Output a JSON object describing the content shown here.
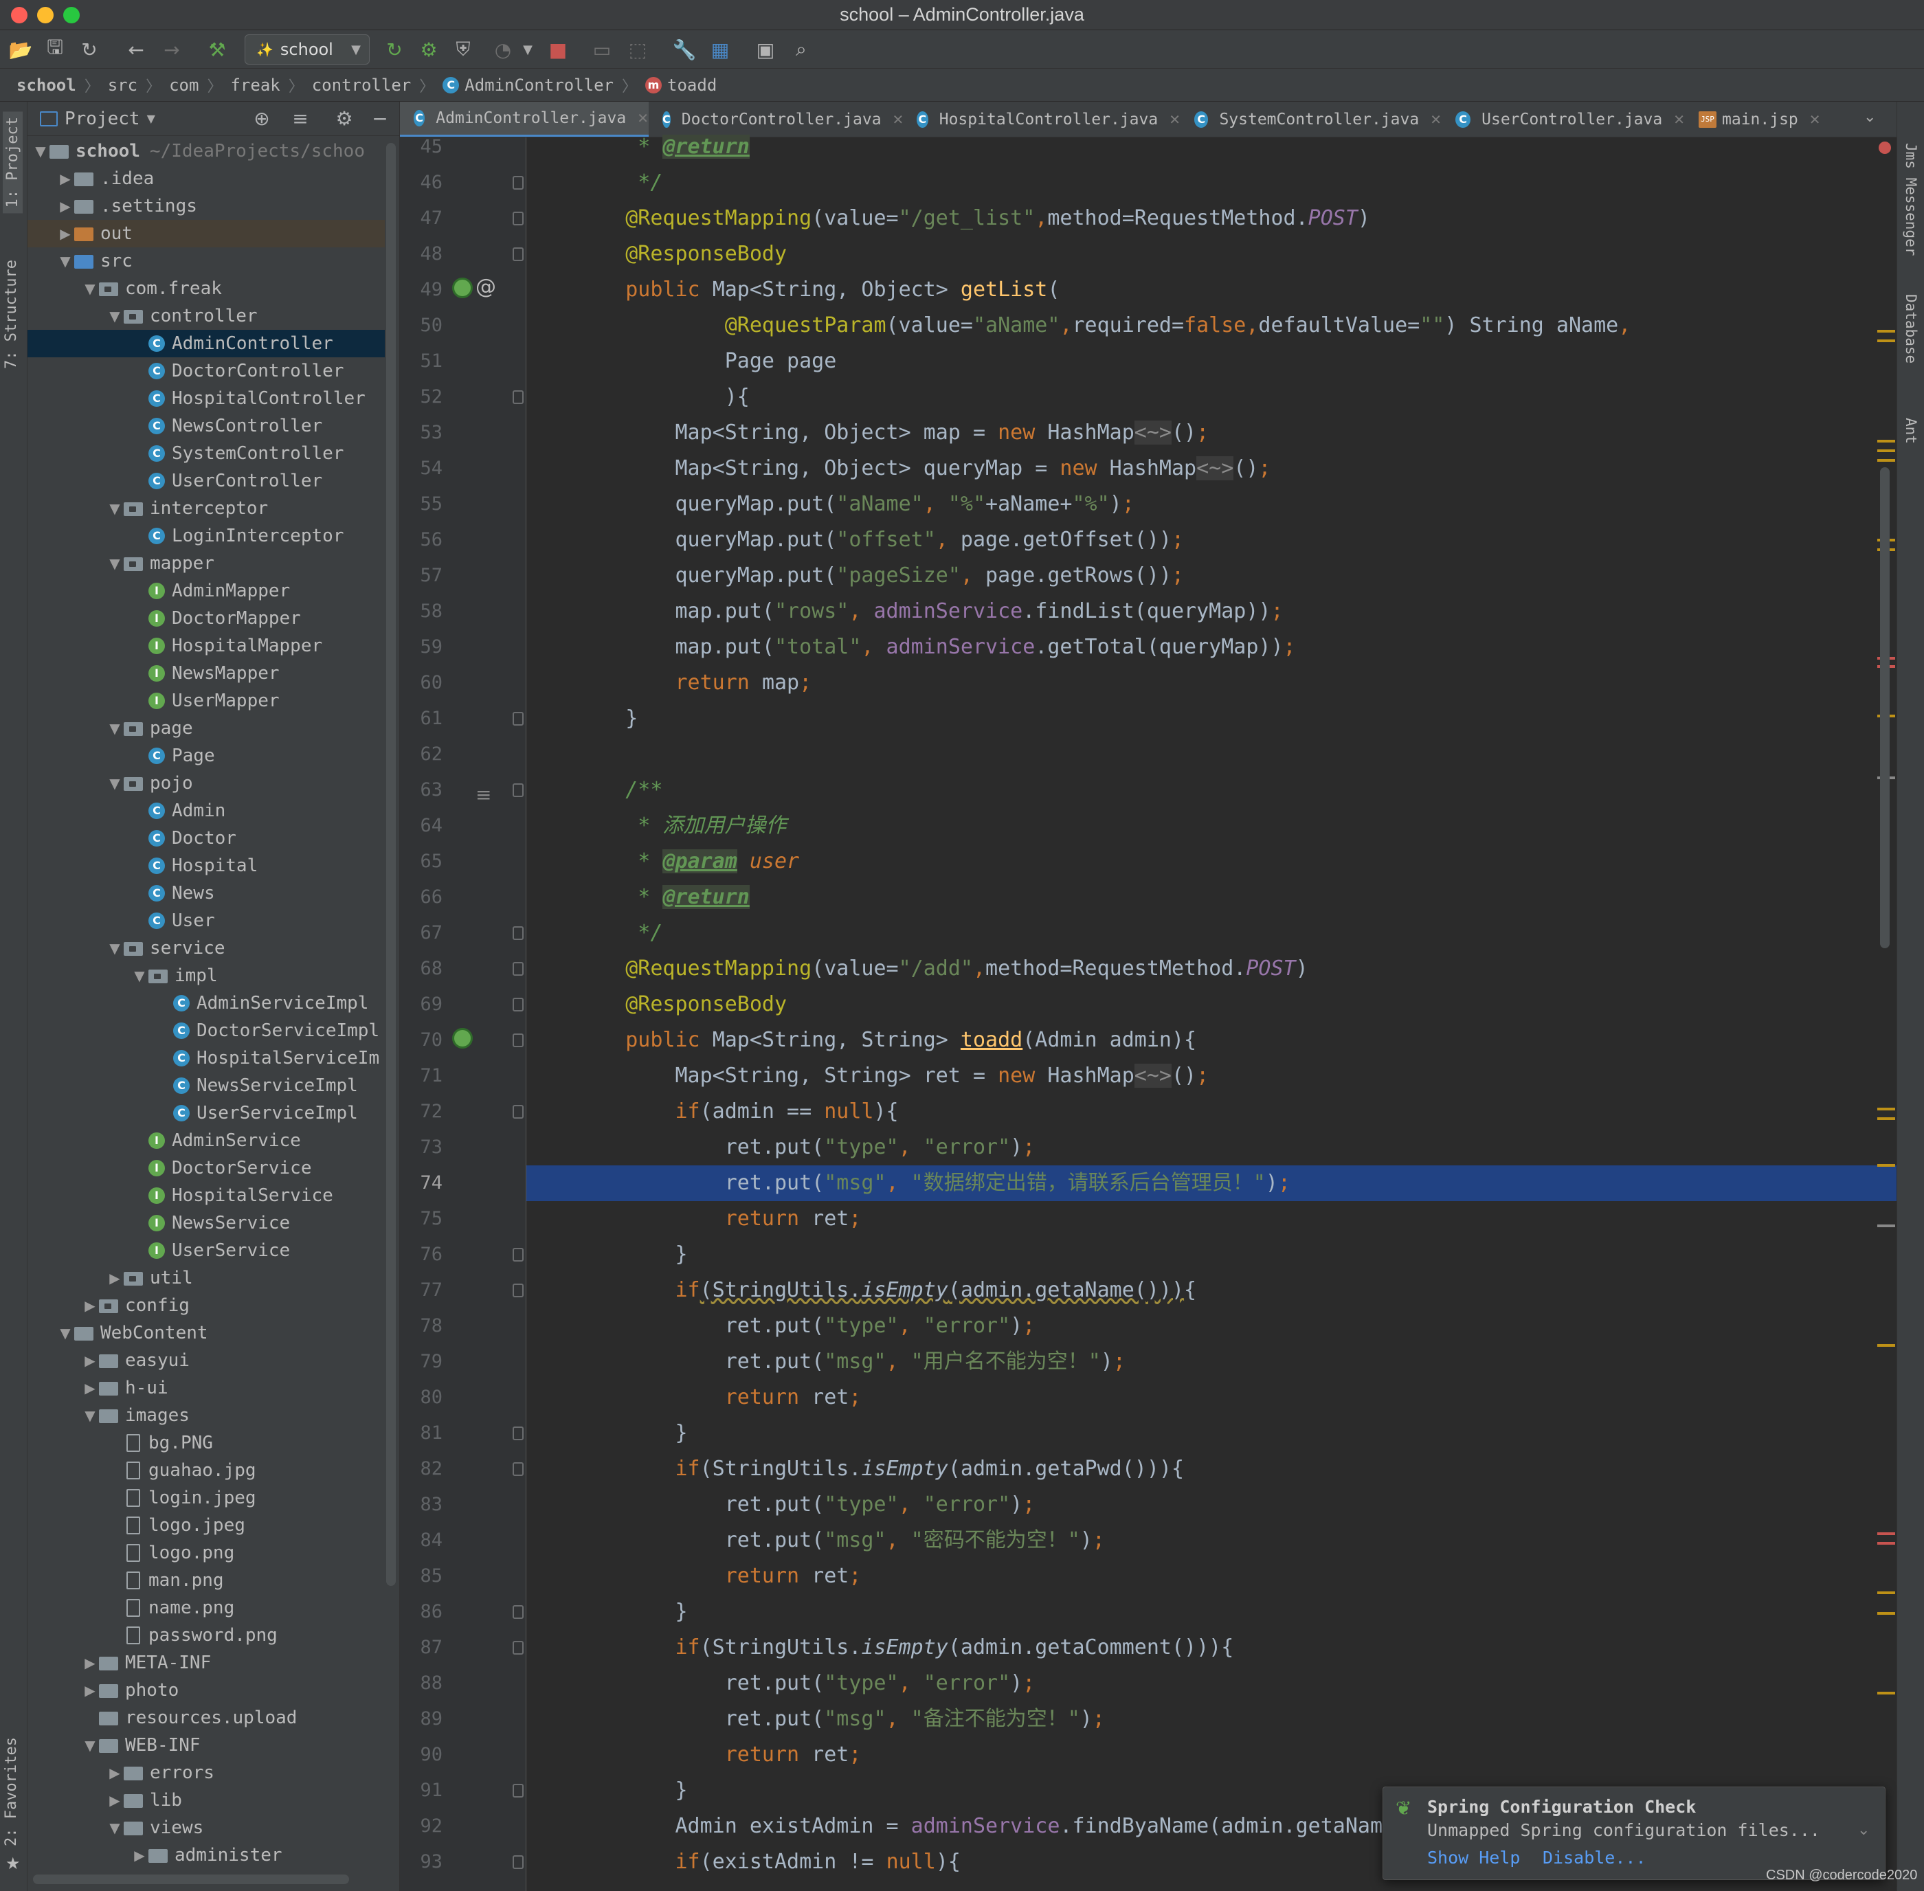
{
  "window": {
    "title": "school – AdminController.java"
  },
  "toolbar": {
    "run_config": "school"
  },
  "breadcrumb": [
    "school",
    "src",
    "com",
    "freak",
    "controller",
    "AdminController",
    "toadd"
  ],
  "left_tabs": {
    "project": "1: Project",
    "structure": "7: Structure",
    "favorites": "2: Favorites"
  },
  "right_tabs": {
    "jms": "Jms Messenger",
    "database": "Database",
    "ant": "Ant"
  },
  "project_panel": {
    "title": "Project"
  },
  "tree": [
    {
      "d": 0,
      "a": "▼",
      "t": "folder",
      "label": "school",
      "path": "~/IdeaProjects/schoo"
    },
    {
      "d": 1,
      "a": "▶",
      "t": "folder",
      "label": ".idea"
    },
    {
      "d": 1,
      "a": "▶",
      "t": "folder",
      "label": ".settings"
    },
    {
      "d": 1,
      "a": "▶",
      "t": "folder-orange",
      "label": "out"
    },
    {
      "d": 1,
      "a": "▼",
      "t": "folder-src",
      "label": "src"
    },
    {
      "d": 2,
      "a": "▼",
      "t": "pkg",
      "label": "com.freak"
    },
    {
      "d": 3,
      "a": "▼",
      "t": "pkg",
      "label": "controller"
    },
    {
      "d": 4,
      "a": "",
      "t": "class",
      "label": "AdminController"
    },
    {
      "d": 4,
      "a": "",
      "t": "class",
      "label": "DoctorController"
    },
    {
      "d": 4,
      "a": "",
      "t": "class",
      "label": "HospitalController"
    },
    {
      "d": 4,
      "a": "",
      "t": "class",
      "label": "NewsController"
    },
    {
      "d": 4,
      "a": "",
      "t": "class",
      "label": "SystemController"
    },
    {
      "d": 4,
      "a": "",
      "t": "class",
      "label": "UserController"
    },
    {
      "d": 3,
      "a": "▼",
      "t": "pkg",
      "label": "interceptor"
    },
    {
      "d": 4,
      "a": "",
      "t": "class",
      "label": "LoginInterceptor"
    },
    {
      "d": 3,
      "a": "▼",
      "t": "pkg",
      "label": "mapper"
    },
    {
      "d": 4,
      "a": "",
      "t": "iface",
      "label": "AdminMapper"
    },
    {
      "d": 4,
      "a": "",
      "t": "iface",
      "label": "DoctorMapper"
    },
    {
      "d": 4,
      "a": "",
      "t": "iface",
      "label": "HospitalMapper"
    },
    {
      "d": 4,
      "a": "",
      "t": "iface",
      "label": "NewsMapper"
    },
    {
      "d": 4,
      "a": "",
      "t": "iface",
      "label": "UserMapper"
    },
    {
      "d": 3,
      "a": "▼",
      "t": "pkg",
      "label": "page"
    },
    {
      "d": 4,
      "a": "",
      "t": "class",
      "label": "Page"
    },
    {
      "d": 3,
      "a": "▼",
      "t": "pkg",
      "label": "pojo"
    },
    {
      "d": 4,
      "a": "",
      "t": "class",
      "label": "Admin"
    },
    {
      "d": 4,
      "a": "",
      "t": "class",
      "label": "Doctor"
    },
    {
      "d": 4,
      "a": "",
      "t": "class",
      "label": "Hospital"
    },
    {
      "d": 4,
      "a": "",
      "t": "class",
      "label": "News"
    },
    {
      "d": 4,
      "a": "",
      "t": "class",
      "label": "User"
    },
    {
      "d": 3,
      "a": "▼",
      "t": "pkg",
      "label": "service"
    },
    {
      "d": 4,
      "a": "▼",
      "t": "pkg",
      "label": "impl"
    },
    {
      "d": 5,
      "a": "",
      "t": "class",
      "label": "AdminServiceImpl"
    },
    {
      "d": 5,
      "a": "",
      "t": "class",
      "label": "DoctorServiceImpl"
    },
    {
      "d": 5,
      "a": "",
      "t": "class",
      "label": "HospitalServiceIm"
    },
    {
      "d": 5,
      "a": "",
      "t": "class",
      "label": "NewsServiceImpl"
    },
    {
      "d": 5,
      "a": "",
      "t": "class",
      "label": "UserServiceImpl"
    },
    {
      "d": 4,
      "a": "",
      "t": "iface",
      "label": "AdminService"
    },
    {
      "d": 4,
      "a": "",
      "t": "iface",
      "label": "DoctorService"
    },
    {
      "d": 4,
      "a": "",
      "t": "iface",
      "label": "HospitalService"
    },
    {
      "d": 4,
      "a": "",
      "t": "iface",
      "label": "NewsService"
    },
    {
      "d": 4,
      "a": "",
      "t": "iface",
      "label": "UserService"
    },
    {
      "d": 3,
      "a": "▶",
      "t": "pkg",
      "label": "util"
    },
    {
      "d": 2,
      "a": "▶",
      "t": "pkg",
      "label": "config"
    },
    {
      "d": 1,
      "a": "▼",
      "t": "folder",
      "label": "WebContent"
    },
    {
      "d": 2,
      "a": "▶",
      "t": "folder",
      "label": "easyui"
    },
    {
      "d": 2,
      "a": "▶",
      "t": "folder",
      "label": "h-ui"
    },
    {
      "d": 2,
      "a": "▼",
      "t": "folder",
      "label": "images"
    },
    {
      "d": 3,
      "a": "",
      "t": "file",
      "label": "bg.PNG"
    },
    {
      "d": 3,
      "a": "",
      "t": "file",
      "label": "guahao.jpg"
    },
    {
      "d": 3,
      "a": "",
      "t": "file",
      "label": "login.jpeg"
    },
    {
      "d": 3,
      "a": "",
      "t": "file",
      "label": "logo.jpeg"
    },
    {
      "d": 3,
      "a": "",
      "t": "file",
      "label": "logo.png"
    },
    {
      "d": 3,
      "a": "",
      "t": "file",
      "label": "man.png"
    },
    {
      "d": 3,
      "a": "",
      "t": "file",
      "label": "name.png"
    },
    {
      "d": 3,
      "a": "",
      "t": "file",
      "label": "password.png"
    },
    {
      "d": 2,
      "a": "▶",
      "t": "folder",
      "label": "META-INF"
    },
    {
      "d": 2,
      "a": "▶",
      "t": "folder",
      "label": "photo"
    },
    {
      "d": 2,
      "a": "",
      "t": "folder",
      "label": "resources.upload"
    },
    {
      "d": 2,
      "a": "▼",
      "t": "folder",
      "label": "WEB-INF"
    },
    {
      "d": 3,
      "a": "▶",
      "t": "folder",
      "label": "errors"
    },
    {
      "d": 3,
      "a": "▶",
      "t": "folder",
      "label": "lib"
    },
    {
      "d": 3,
      "a": "▼",
      "t": "folder",
      "label": "views"
    },
    {
      "d": 4,
      "a": "▶",
      "t": "folder",
      "label": "administer"
    }
  ],
  "tabs": [
    {
      "label": "AdminController.java",
      "icon": "C",
      "active": true
    },
    {
      "label": "DoctorController.java",
      "icon": "C"
    },
    {
      "label": "HospitalController.java",
      "icon": "C"
    },
    {
      "label": "SystemController.java",
      "icon": "C"
    },
    {
      "label": "UserController.java",
      "icon": "C"
    },
    {
      "label": "main.jsp",
      "icon": "JSP"
    }
  ],
  "editor": {
    "first_line": 45,
    "current_line": 74,
    "lines": [
      [
        [
          "cmt",
          "     * "
        ],
        [
          "doctag",
          "@return"
        ]
      ],
      [
        [
          "cmt",
          "     */"
        ]
      ],
      [
        [
          "ann",
          "    @RequestMapping"
        ],
        [
          "",
          "("
        ],
        [
          "",
          "value="
        ],
        [
          "str",
          "\"/get_list\""
        ],
        [
          "kw",
          ","
        ],
        [
          "",
          "method=RequestMethod."
        ],
        [
          "itf",
          "POST"
        ],
        [
          "",
          ")"
        ]
      ],
      [
        [
          "ann",
          "    @ResponseBody"
        ]
      ],
      [
        [
          "kw",
          "    public "
        ],
        [
          "",
          "Map<String, Object> "
        ],
        [
          "fn",
          "getList"
        ],
        [
          "",
          "("
        ]
      ],
      [
        [
          "ann",
          "            @RequestParam"
        ],
        [
          "",
          "(value="
        ],
        [
          "str",
          "\"aName\""
        ],
        [
          "kw",
          ","
        ],
        [
          "",
          "required="
        ],
        [
          "kw",
          "false"
        ],
        [
          "kw",
          ","
        ],
        [
          "",
          "defaultValue="
        ],
        [
          "str",
          "\"\""
        ],
        [
          "",
          ") String aName"
        ],
        [
          "kw",
          ","
        ]
      ],
      [
        [
          "",
          "            Page page"
        ]
      ],
      [
        [
          "",
          "            ){"
        ]
      ],
      [
        [
          "",
          "        Map<String, Object> map = "
        ],
        [
          "kw",
          "new "
        ],
        [
          "",
          "HashMap"
        ],
        [
          "diam",
          "<~>"
        ],
        [
          "",
          "()"
        ],
        [
          "kw",
          ";"
        ]
      ],
      [
        [
          "",
          "        Map<String, Object> queryMap = "
        ],
        [
          "kw",
          "new "
        ],
        [
          "",
          "HashMap"
        ],
        [
          "diam",
          "<~>"
        ],
        [
          "",
          "()"
        ],
        [
          "kw",
          ";"
        ]
      ],
      [
        [
          "",
          "        queryMap.put("
        ],
        [
          "str",
          "\"aName\""
        ],
        [
          "kw",
          ", "
        ],
        [
          "str",
          "\"%\""
        ],
        [
          "",
          "+aName+"
        ],
        [
          "str",
          "\"%\""
        ],
        [
          "",
          ")"
        ],
        [
          "kw",
          ";"
        ]
      ],
      [
        [
          "",
          "        queryMap.put("
        ],
        [
          "str",
          "\"offset\""
        ],
        [
          "kw",
          ", "
        ],
        [
          "",
          "page.getOffset())"
        ],
        [
          "kw",
          ";"
        ]
      ],
      [
        [
          "",
          "        queryMap.put("
        ],
        [
          "str",
          "\"pageSize\""
        ],
        [
          "kw",
          ", "
        ],
        [
          "",
          "page.getRows())"
        ],
        [
          "kw",
          ";"
        ]
      ],
      [
        [
          "",
          "        map.put("
        ],
        [
          "str",
          "\"rows\""
        ],
        [
          "kw",
          ", "
        ],
        [
          "fld",
          "adminService"
        ],
        [
          "",
          ".findList(queryMap))"
        ],
        [
          "kw",
          ";"
        ]
      ],
      [
        [
          "",
          "        map.put("
        ],
        [
          "str",
          "\"total\""
        ],
        [
          "kw",
          ", "
        ],
        [
          "fld",
          "adminService"
        ],
        [
          "",
          ".getTotal(queryMap))"
        ],
        [
          "kw",
          ";"
        ]
      ],
      [
        [
          "kw",
          "        return "
        ],
        [
          "",
          "map"
        ],
        [
          "kw",
          ";"
        ]
      ],
      [
        [
          "",
          "    }"
        ]
      ],
      [
        [
          "",
          ""
        ]
      ],
      [
        [
          "cmt",
          "    /**"
        ]
      ],
      [
        [
          "cmt",
          "     * 添加用户操作"
        ]
      ],
      [
        [
          "cmt",
          "     * "
        ],
        [
          "doctag",
          "@param"
        ],
        [
          "docparam",
          " user"
        ]
      ],
      [
        [
          "cmt",
          "     * "
        ],
        [
          "doctag",
          "@return"
        ]
      ],
      [
        [
          "cmt",
          "     */"
        ]
      ],
      [
        [
          "ann",
          "    @RequestMapping"
        ],
        [
          "",
          "(value="
        ],
        [
          "str",
          "\"/add\""
        ],
        [
          "kw",
          ","
        ],
        [
          "",
          "method=RequestMethod."
        ],
        [
          "itf",
          "POST"
        ],
        [
          "",
          ")"
        ]
      ],
      [
        [
          "ann",
          "    @ResponseBody"
        ]
      ],
      [
        [
          "kw",
          "    public "
        ],
        [
          "",
          "Map<String, String> "
        ],
        [
          "fnu",
          "toadd"
        ],
        [
          "",
          "(Admin admin){"
        ]
      ],
      [
        [
          "",
          "        Map<String, String> ret = "
        ],
        [
          "kw",
          "new "
        ],
        [
          "",
          "HashMap"
        ],
        [
          "diam",
          "<~>"
        ],
        [
          "",
          "()"
        ],
        [
          "kw",
          ";"
        ]
      ],
      [
        [
          "kw",
          "        if"
        ],
        [
          "",
          "(admin == "
        ],
        [
          "kw",
          "null"
        ],
        [
          "",
          "){"
        ]
      ],
      [
        [
          "",
          "            ret.put("
        ],
        [
          "str",
          "\"type\""
        ],
        [
          "kw",
          ", "
        ],
        [
          "str",
          "\"error\""
        ],
        [
          "",
          ")"
        ],
        [
          "kw",
          ";"
        ]
      ],
      [
        [
          "",
          "            ret.put("
        ],
        [
          "str",
          "\"msg\""
        ],
        [
          "kw",
          ", "
        ],
        [
          "str",
          "\"数据绑定出错，请联系后台管理员！\""
        ],
        [
          "",
          ")"
        ],
        [
          "kw",
          ";"
        ]
      ],
      [
        [
          "kw",
          "            return "
        ],
        [
          "",
          "ret"
        ],
        [
          "kw",
          ";"
        ]
      ],
      [
        [
          "",
          "        }"
        ]
      ],
      [
        [
          "kw",
          "        if"
        ],
        [
          "under",
          "(StringUtils."
        ],
        [
          "under it",
          "isEmpty"
        ],
        [
          "under",
          "(admin.getaName()))"
        ],
        [
          "",
          "{"
        ]
      ],
      [
        [
          "",
          "            ret.put("
        ],
        [
          "str",
          "\"type\""
        ],
        [
          "kw",
          ", "
        ],
        [
          "str",
          "\"error\""
        ],
        [
          "",
          ")"
        ],
        [
          "kw",
          ";"
        ]
      ],
      [
        [
          "",
          "            ret.put("
        ],
        [
          "str",
          "\"msg\""
        ],
        [
          "kw",
          ", "
        ],
        [
          "str",
          "\"用户名不能为空！\""
        ],
        [
          "",
          ")"
        ],
        [
          "kw",
          ";"
        ]
      ],
      [
        [
          "kw",
          "            return "
        ],
        [
          "",
          "ret"
        ],
        [
          "kw",
          ";"
        ]
      ],
      [
        [
          "",
          "        }"
        ]
      ],
      [
        [
          "kw",
          "        if"
        ],
        [
          "",
          "(StringUtils."
        ],
        [
          "it",
          "isEmpty"
        ],
        [
          "",
          "(admin.getaPwd())){"
        ]
      ],
      [
        [
          "",
          "            ret.put("
        ],
        [
          "str",
          "\"type\""
        ],
        [
          "kw",
          ", "
        ],
        [
          "str",
          "\"error\""
        ],
        [
          "",
          ")"
        ],
        [
          "kw",
          ";"
        ]
      ],
      [
        [
          "",
          "            ret.put("
        ],
        [
          "str",
          "\"msg\""
        ],
        [
          "kw",
          ", "
        ],
        [
          "str",
          "\"密码不能为空！\""
        ],
        [
          "",
          ")"
        ],
        [
          "kw",
          ";"
        ]
      ],
      [
        [
          "kw",
          "            return "
        ],
        [
          "",
          "ret"
        ],
        [
          "kw",
          ";"
        ]
      ],
      [
        [
          "",
          "        }"
        ]
      ],
      [
        [
          "kw",
          "        if"
        ],
        [
          "",
          "(StringUtils."
        ],
        [
          "it",
          "isEmpty"
        ],
        [
          "",
          "(admin.getaComment())){"
        ]
      ],
      [
        [
          "",
          "            ret.put("
        ],
        [
          "str",
          "\"type\""
        ],
        [
          "kw",
          ", "
        ],
        [
          "str",
          "\"error\""
        ],
        [
          "",
          ")"
        ],
        [
          "kw",
          ";"
        ]
      ],
      [
        [
          "",
          "            ret.put("
        ],
        [
          "str",
          "\"msg\""
        ],
        [
          "kw",
          ", "
        ],
        [
          "str",
          "\"备注不能为空！\""
        ],
        [
          "",
          ")"
        ],
        [
          "kw",
          ";"
        ]
      ],
      [
        [
          "kw",
          "            return "
        ],
        [
          "",
          "ret"
        ],
        [
          "kw",
          ";"
        ]
      ],
      [
        [
          "",
          "        }"
        ]
      ],
      [
        [
          "",
          "        Admin existAdmin = "
        ],
        [
          "fld",
          "adminService"
        ],
        [
          "",
          ".findByaName(admin.getaName())"
        ],
        [
          "kw",
          ";"
        ]
      ],
      [
        [
          "kw",
          "        if"
        ],
        [
          "",
          "(existAdmin != "
        ],
        [
          "kw",
          "null"
        ],
        [
          "",
          "){"
        ]
      ]
    ]
  },
  "notification": {
    "title": "Spring Configuration Check",
    "body": "Unmapped Spring configuration files...",
    "show_help": "Show Help",
    "disable": "Disable..."
  },
  "watermark": "CSDN @codercode2020",
  "colors": {
    "accent": "#4a88c7",
    "selection": "#214283",
    "keyword": "#cc7832",
    "string": "#6a8759",
    "annotation": "#bbb529"
  }
}
